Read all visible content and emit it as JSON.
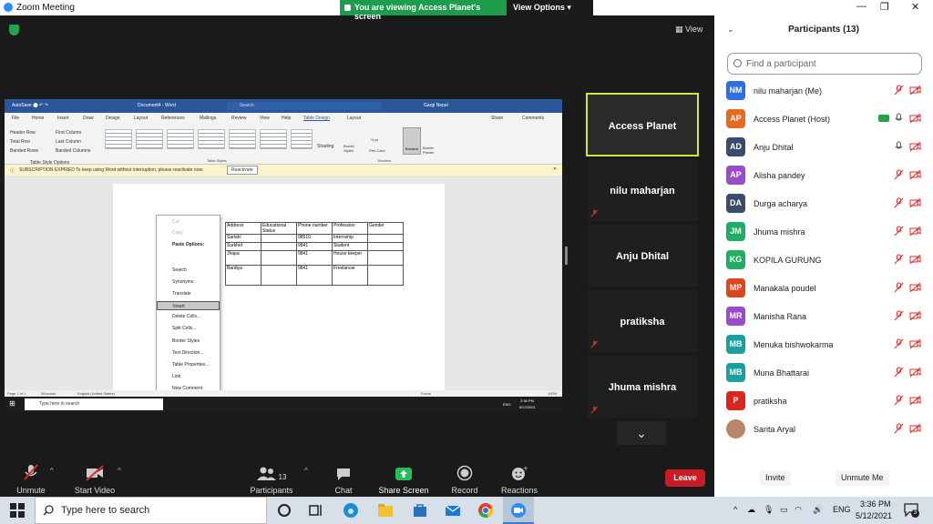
{
  "window": {
    "title": "Zoom Meeting"
  },
  "banner": {
    "viewing": "You are viewing Access Planet's screen",
    "view_options": "View Options"
  },
  "view_button": "View",
  "shared": {
    "word_doc": "Document4 - Word",
    "word_search": "Search",
    "word_user": "Gargi Nepal",
    "tabs": [
      "File",
      "Home",
      "Insert",
      "Draw",
      "Design",
      "Layout",
      "References",
      "Mailings",
      "Review",
      "View",
      "Help",
      "Table Design",
      "Layout"
    ],
    "share": "Share",
    "comments": "Comments",
    "style_opts": [
      "Header Row",
      "First Column",
      "Total Row",
      "Last Column",
      "Banded Rows",
      "Banded Columns"
    ],
    "style_opts_title": "Table Style Options",
    "table_styles_title": "Table Styles",
    "borders_title": "Borders",
    "shading": "Shading",
    "border_styles": "Border Styles",
    "pen_color": "Pen Color",
    "pen_weight": "½ pt",
    "borders_btn": "Borders",
    "border_painter": "Border Painter",
    "warning": "SUBSCRIPTION EXPIRED  To keep using Word without interruption, please reactivate now.",
    "reactivate": "Reactivate",
    "table_header": [
      "Address",
      "Educational Status",
      "Phone number",
      "Profession",
      "Gender"
    ],
    "table_rows": [
      [
        "Sarlahi",
        "",
        "98510",
        "Internship",
        ""
      ],
      [
        "Surkhet",
        "",
        "9841",
        "Student",
        ""
      ],
      [
        "Jhapa",
        "",
        "9841",
        "House keeper",
        ""
      ],
      [
        "Bardiya",
        "",
        "9841",
        "Freelancer",
        ""
      ]
    ],
    "context_menu": [
      "Cut",
      "Copy",
      "Paste Options:",
      "Search",
      "Synonyms",
      "Translate",
      "Insert",
      "Delete Cells...",
      "Split Cells...",
      "Border Styles",
      "Text Direction...",
      "Table Properties...",
      "Link",
      "New Comment"
    ],
    "status": [
      "Page 1 of 1",
      "36 words",
      "English (United States)",
      "Focus",
      "100%"
    ],
    "task_search": "Type here to search",
    "task_time": "3:36 PM",
    "task_date": "5/12/2021",
    "task_lang": "ENG"
  },
  "thumbnails": [
    "Access Planet",
    "nilu maharjan",
    "Anju Dhital",
    "pratiksha",
    "Jhuma mishra"
  ],
  "participants": {
    "title": "Participants (13)",
    "search_placeholder": "Find a participant",
    "list": [
      {
        "initials": "NM",
        "name": "nilu maharjan (Me)",
        "color": "#2d6de6"
      },
      {
        "initials": "AP",
        "name": "Access Planet (Host)",
        "color": "#e86a1f"
      },
      {
        "initials": "AD",
        "name": "Anju Dhital",
        "color": "#3a4c6b"
      },
      {
        "initials": "AP",
        "name": "Alisha pandey",
        "color": "#9a4bcc"
      },
      {
        "initials": "DA",
        "name": "Durga acharya",
        "color": "#3a4c6b"
      },
      {
        "initials": "JM",
        "name": "Jhuma mishra",
        "color": "#1fae62"
      },
      {
        "initials": "KG",
        "name": "KOPILA GURUNG",
        "color": "#1fae62"
      },
      {
        "initials": "MP",
        "name": "Manakala poudel",
        "color": "#e0431e"
      },
      {
        "initials": "MR",
        "name": "Manisha Rana",
        "color": "#9a4bcc"
      },
      {
        "initials": "MB",
        "name": "Menuka bishwokarma",
        "color": "#1aa0a0"
      },
      {
        "initials": "MB",
        "name": "Muna Bhattarai",
        "color": "#1aa0a0"
      },
      {
        "initials": "P",
        "name": "pratiksha",
        "color": "#d6281f"
      },
      {
        "initials": "",
        "name": "Sarita Aryal",
        "color": "#b8866a"
      }
    ],
    "invite": "Invite",
    "unmute_me": "Unmute Me"
  },
  "toolbar": {
    "unmute": "Unmute",
    "start_video": "Start Video",
    "participants": "Participants",
    "participants_count": "13",
    "chat": "Chat",
    "share_screen": "Share Screen",
    "record": "Record",
    "reactions": "Reactions",
    "leave": "Leave"
  },
  "taskbar": {
    "search": "Type here to search",
    "time": "3:36 PM",
    "date": "5/12/2021",
    "lang": "ENG",
    "notif_count": "3"
  }
}
